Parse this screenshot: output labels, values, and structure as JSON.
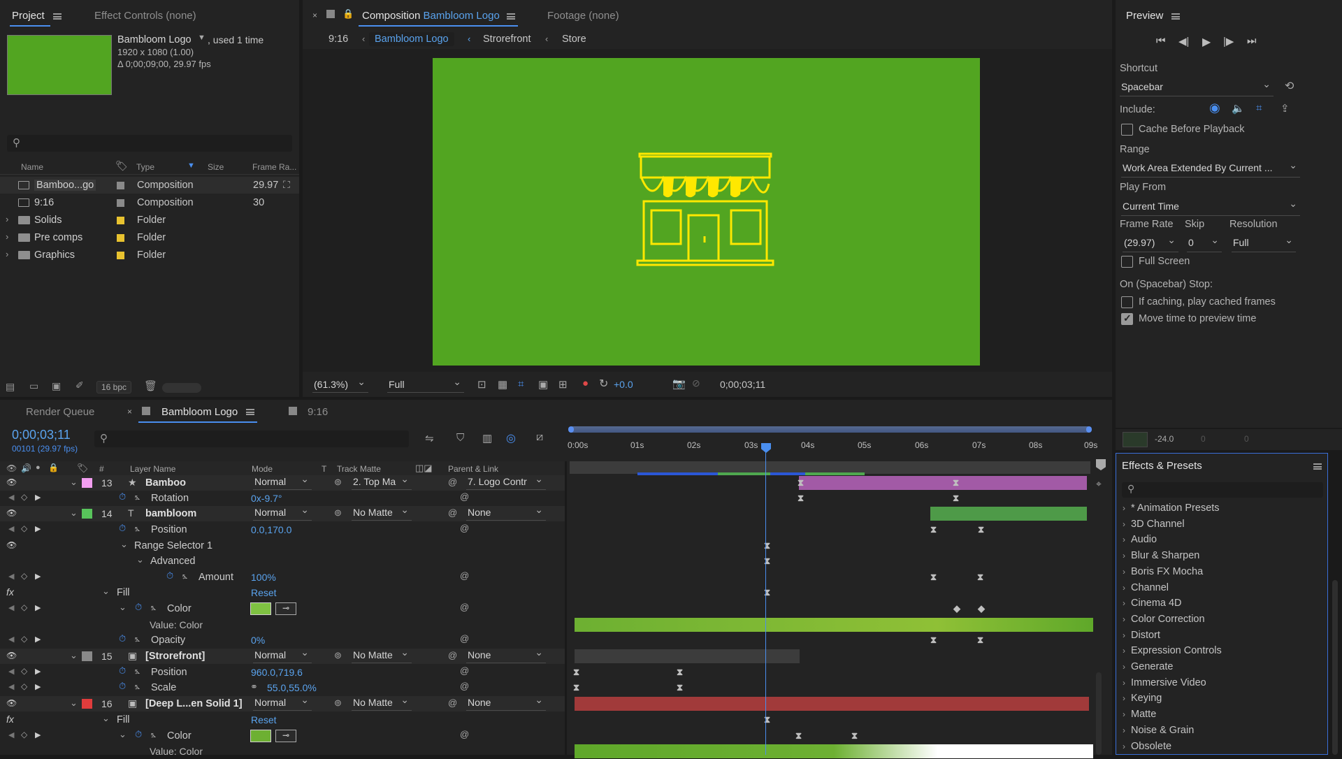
{
  "project": {
    "tab": "Project",
    "effect_controls": "Effect Controls (none)",
    "comp_name": "Bambloom Logo",
    "used": ", used 1 time",
    "size": "1920 x 1080 (1.00)",
    "duration": "Δ 0;00;09;00, 29.97 fps",
    "search_placeholder": "",
    "columns": {
      "name": "Name",
      "type": "Type",
      "size": "Size",
      "frame_rate": "Frame Ra..."
    },
    "items": [
      {
        "name": "Bamboo...go",
        "type": "Composition",
        "rate": "29.97",
        "label_color": "#8a8a8a",
        "kind": "comp"
      },
      {
        "name": "9:16",
        "type": "Composition",
        "rate": "30",
        "label_color": "#8a8a8a",
        "kind": "comp"
      },
      {
        "name": "Solids",
        "type": "Folder",
        "rate": "",
        "label_color": "#e8c22f",
        "kind": "folder"
      },
      {
        "name": "Pre comps",
        "type": "Folder",
        "rate": "",
        "label_color": "#e8c22f",
        "kind": "folder"
      },
      {
        "name": "Graphics",
        "type": "Folder",
        "rate": "",
        "label_color": "#e8c22f",
        "kind": "folder"
      }
    ],
    "bpc": "16 bpc"
  },
  "viewer": {
    "tab_prefix": "Composition",
    "tab_name": "Bambloom Logo",
    "footage": "Footage (none)",
    "breadcrumbs": [
      "9:16",
      "Bambloom Logo",
      "Strorefront",
      "Store"
    ],
    "zoom": "(61.3%)",
    "resolution": "Full",
    "exposure": "+0.0",
    "timecode": "0;00;03;11",
    "canvas_color": "#52a521"
  },
  "preview": {
    "title": "Preview",
    "shortcut_label": "Shortcut",
    "shortcut": "Spacebar",
    "include_label": "Include:",
    "cache_label": "Cache Before Playback",
    "range_label": "Range",
    "range": "Work Area Extended By Current ...",
    "play_from_label": "Play From",
    "play_from": "Current Time",
    "frame_rate_label": "Frame Rate",
    "skip_label": "Skip",
    "resolution_label": "Resolution",
    "frame_rate": "(29.97)",
    "skip": "0",
    "resolution": "Full",
    "full_screen_label": "Full Screen",
    "stop_label": "On (Spacebar) Stop:",
    "if_caching_label": "If caching, play cached frames",
    "move_time_label": "Move time to preview time",
    "cache_checked": false,
    "full_screen_checked": false,
    "if_caching_checked": false,
    "move_time_checked": true
  },
  "audio": {
    "db": "-24.0",
    "v1": "0",
    "v2": "0"
  },
  "effects": {
    "title": "Effects & Presets",
    "items": [
      "* Animation Presets",
      "3D Channel",
      "Audio",
      "Blur & Sharpen",
      "Boris FX Mocha",
      "Channel",
      "Cinema 4D",
      "Color Correction",
      "Distort",
      "Expression Controls",
      "Generate",
      "Immersive Video",
      "Keying",
      "Matte",
      "Noise & Grain",
      "Obsolete"
    ]
  },
  "timeline": {
    "render_queue": "Render Queue",
    "comp_tab": "Bambloom Logo",
    "other_tab": "9:16",
    "timecode": "0;00;03;11",
    "frames": "00101 (29.97 fps)",
    "headers": {
      "num": "#",
      "layer": "Layer Name",
      "mode": "Mode",
      "t": "T",
      "track": "Track Matte",
      "parent": "Parent & Link"
    },
    "ruler": [
      "0:00s",
      "01s",
      "02s",
      "03s",
      "04s",
      "05s",
      "06s",
      "07s",
      "08s",
      "09s"
    ],
    "rows": [
      {
        "type": "layer",
        "num": "13",
        "name": "Bamboo",
        "mode": "Normal",
        "track": "2. Top Ma",
        "parent": "7. Logo Contr",
        "color": "#f29ef0"
      },
      {
        "type": "prop",
        "name": "Rotation",
        "value": "0x-9.7°"
      },
      {
        "type": "layer",
        "num": "14",
        "name": "bambloom",
        "mode": "Normal",
        "track": "No Matte",
        "parent": "None",
        "color": "#58c45b"
      },
      {
        "type": "prop",
        "name": "Position",
        "value": "0.0,170.0"
      },
      {
        "type": "group",
        "name": "Range Selector 1"
      },
      {
        "type": "group",
        "name": "Advanced"
      },
      {
        "type": "prop",
        "name": "Amount",
        "value": "100%"
      },
      {
        "type": "fx",
        "name": "Fill",
        "value": "Reset"
      },
      {
        "type": "prop",
        "name": "Color",
        "value": ""
      },
      {
        "type": "sub",
        "name": "Value: Color"
      },
      {
        "type": "prop",
        "name": "Opacity",
        "value": "0%"
      },
      {
        "type": "layer",
        "num": "15",
        "name": "[Strorefront]",
        "mode": "Normal",
        "track": "No Matte",
        "parent": "None",
        "color": "#8a8a8a"
      },
      {
        "type": "prop",
        "name": "Position",
        "value": "960.0,719.6"
      },
      {
        "type": "prop",
        "name": "Scale",
        "value": "55.0,55.0%"
      },
      {
        "type": "layer",
        "num": "16",
        "name": "[Deep L...en Solid 1]",
        "mode": "Normal",
        "track": "No Matte",
        "parent": "None",
        "color": "#e03c3c"
      },
      {
        "type": "fx",
        "name": "Fill",
        "value": "Reset"
      },
      {
        "type": "prop",
        "name": "Color",
        "value": ""
      },
      {
        "type": "sub",
        "name": "Value: Color"
      }
    ]
  }
}
